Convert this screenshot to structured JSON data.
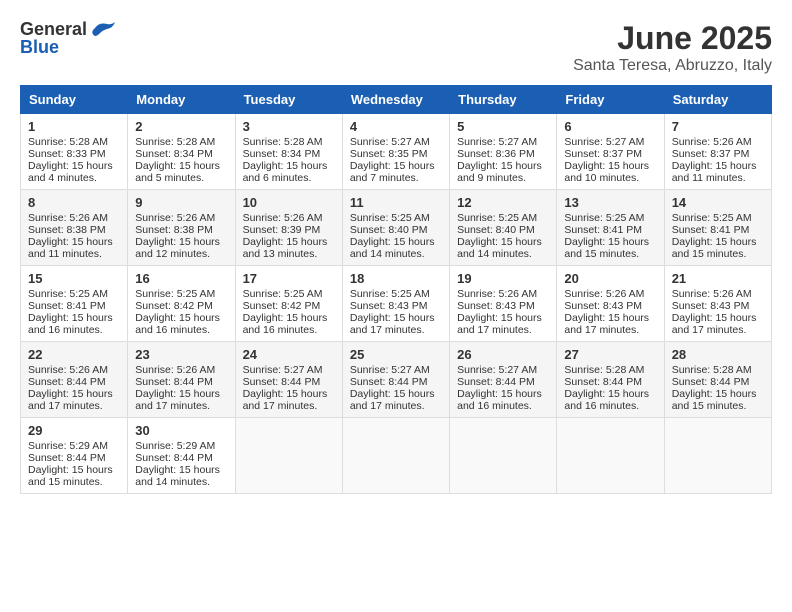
{
  "logo": {
    "text_general": "General",
    "text_blue": "Blue"
  },
  "title": "June 2025",
  "location": "Santa Teresa, Abruzzo, Italy",
  "days_header": [
    "Sunday",
    "Monday",
    "Tuesday",
    "Wednesday",
    "Thursday",
    "Friday",
    "Saturday"
  ],
  "weeks": [
    [
      {
        "day": "1",
        "lines": [
          "Sunrise: 5:28 AM",
          "Sunset: 8:33 PM",
          "Daylight: 15 hours",
          "and 4 minutes."
        ]
      },
      {
        "day": "2",
        "lines": [
          "Sunrise: 5:28 AM",
          "Sunset: 8:34 PM",
          "Daylight: 15 hours",
          "and 5 minutes."
        ]
      },
      {
        "day": "3",
        "lines": [
          "Sunrise: 5:28 AM",
          "Sunset: 8:34 PM",
          "Daylight: 15 hours",
          "and 6 minutes."
        ]
      },
      {
        "day": "4",
        "lines": [
          "Sunrise: 5:27 AM",
          "Sunset: 8:35 PM",
          "Daylight: 15 hours",
          "and 7 minutes."
        ]
      },
      {
        "day": "5",
        "lines": [
          "Sunrise: 5:27 AM",
          "Sunset: 8:36 PM",
          "Daylight: 15 hours",
          "and 9 minutes."
        ]
      },
      {
        "day": "6",
        "lines": [
          "Sunrise: 5:27 AM",
          "Sunset: 8:37 PM",
          "Daylight: 15 hours",
          "and 10 minutes."
        ]
      },
      {
        "day": "7",
        "lines": [
          "Sunrise: 5:26 AM",
          "Sunset: 8:37 PM",
          "Daylight: 15 hours",
          "and 11 minutes."
        ]
      }
    ],
    [
      {
        "day": "8",
        "lines": [
          "Sunrise: 5:26 AM",
          "Sunset: 8:38 PM",
          "Daylight: 15 hours",
          "and 11 minutes."
        ]
      },
      {
        "day": "9",
        "lines": [
          "Sunrise: 5:26 AM",
          "Sunset: 8:38 PM",
          "Daylight: 15 hours",
          "and 12 minutes."
        ]
      },
      {
        "day": "10",
        "lines": [
          "Sunrise: 5:26 AM",
          "Sunset: 8:39 PM",
          "Daylight: 15 hours",
          "and 13 minutes."
        ]
      },
      {
        "day": "11",
        "lines": [
          "Sunrise: 5:25 AM",
          "Sunset: 8:40 PM",
          "Daylight: 15 hours",
          "and 14 minutes."
        ]
      },
      {
        "day": "12",
        "lines": [
          "Sunrise: 5:25 AM",
          "Sunset: 8:40 PM",
          "Daylight: 15 hours",
          "and 14 minutes."
        ]
      },
      {
        "day": "13",
        "lines": [
          "Sunrise: 5:25 AM",
          "Sunset: 8:41 PM",
          "Daylight: 15 hours",
          "and 15 minutes."
        ]
      },
      {
        "day": "14",
        "lines": [
          "Sunrise: 5:25 AM",
          "Sunset: 8:41 PM",
          "Daylight: 15 hours",
          "and 15 minutes."
        ]
      }
    ],
    [
      {
        "day": "15",
        "lines": [
          "Sunrise: 5:25 AM",
          "Sunset: 8:41 PM",
          "Daylight: 15 hours",
          "and 16 minutes."
        ]
      },
      {
        "day": "16",
        "lines": [
          "Sunrise: 5:25 AM",
          "Sunset: 8:42 PM",
          "Daylight: 15 hours",
          "and 16 minutes."
        ]
      },
      {
        "day": "17",
        "lines": [
          "Sunrise: 5:25 AM",
          "Sunset: 8:42 PM",
          "Daylight: 15 hours",
          "and 16 minutes."
        ]
      },
      {
        "day": "18",
        "lines": [
          "Sunrise: 5:25 AM",
          "Sunset: 8:43 PM",
          "Daylight: 15 hours",
          "and 17 minutes."
        ]
      },
      {
        "day": "19",
        "lines": [
          "Sunrise: 5:26 AM",
          "Sunset: 8:43 PM",
          "Daylight: 15 hours",
          "and 17 minutes."
        ]
      },
      {
        "day": "20",
        "lines": [
          "Sunrise: 5:26 AM",
          "Sunset: 8:43 PM",
          "Daylight: 15 hours",
          "and 17 minutes."
        ]
      },
      {
        "day": "21",
        "lines": [
          "Sunrise: 5:26 AM",
          "Sunset: 8:43 PM",
          "Daylight: 15 hours",
          "and 17 minutes."
        ]
      }
    ],
    [
      {
        "day": "22",
        "lines": [
          "Sunrise: 5:26 AM",
          "Sunset: 8:44 PM",
          "Daylight: 15 hours",
          "and 17 minutes."
        ]
      },
      {
        "day": "23",
        "lines": [
          "Sunrise: 5:26 AM",
          "Sunset: 8:44 PM",
          "Daylight: 15 hours",
          "and 17 minutes."
        ]
      },
      {
        "day": "24",
        "lines": [
          "Sunrise: 5:27 AM",
          "Sunset: 8:44 PM",
          "Daylight: 15 hours",
          "and 17 minutes."
        ]
      },
      {
        "day": "25",
        "lines": [
          "Sunrise: 5:27 AM",
          "Sunset: 8:44 PM",
          "Daylight: 15 hours",
          "and 17 minutes."
        ]
      },
      {
        "day": "26",
        "lines": [
          "Sunrise: 5:27 AM",
          "Sunset: 8:44 PM",
          "Daylight: 15 hours",
          "and 16 minutes."
        ]
      },
      {
        "day": "27",
        "lines": [
          "Sunrise: 5:28 AM",
          "Sunset: 8:44 PM",
          "Daylight: 15 hours",
          "and 16 minutes."
        ]
      },
      {
        "day": "28",
        "lines": [
          "Sunrise: 5:28 AM",
          "Sunset: 8:44 PM",
          "Daylight: 15 hours",
          "and 15 minutes."
        ]
      }
    ],
    [
      {
        "day": "29",
        "lines": [
          "Sunrise: 5:29 AM",
          "Sunset: 8:44 PM",
          "Daylight: 15 hours",
          "and 15 minutes."
        ]
      },
      {
        "day": "30",
        "lines": [
          "Sunrise: 5:29 AM",
          "Sunset: 8:44 PM",
          "Daylight: 15 hours",
          "and 14 minutes."
        ]
      },
      null,
      null,
      null,
      null,
      null
    ]
  ]
}
